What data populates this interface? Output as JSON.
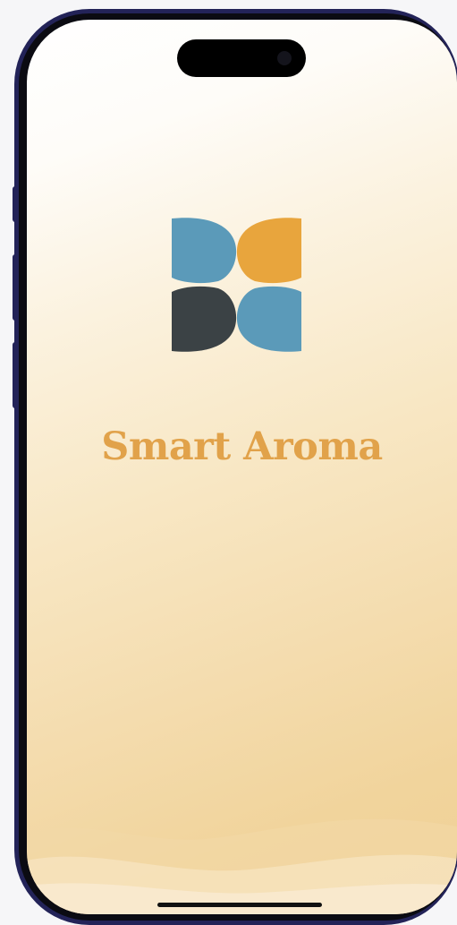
{
  "app": {
    "title": "Smart Aroma"
  },
  "logo": {
    "icon": "four-petal-logo-icon",
    "colors": {
      "top_left": "#5b9ab9",
      "top_right": "#e8a53d",
      "bottom_left": "#3b4245",
      "bottom_right": "#5b9ab9"
    }
  },
  "colors": {
    "title": "#e1a24a",
    "frame": "#232358"
  }
}
